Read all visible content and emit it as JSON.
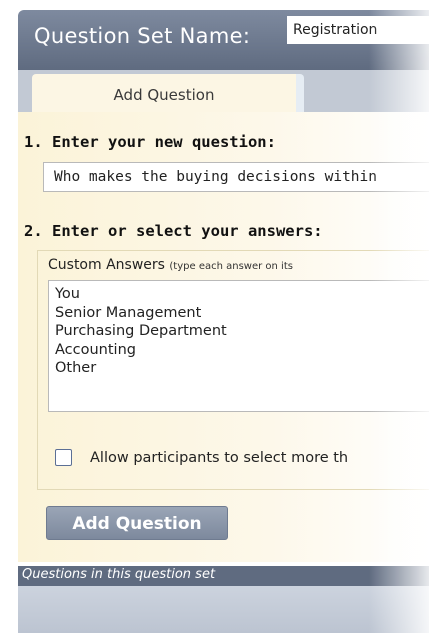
{
  "header": {
    "label": "Question Set Name:",
    "name_value": "Registration"
  },
  "tabs": [
    {
      "label": "Add Question",
      "active": true
    }
  ],
  "step1": {
    "label": "1. Enter your new question:",
    "question_value": "Who makes the buying decisions within"
  },
  "step2": {
    "label": "2. Enter or select your answers:",
    "custom_answers_label": "Custom Answers",
    "custom_answers_hint": "(type each answer on its",
    "answers": [
      "You",
      "Senior Management",
      "Purchasing Department",
      "Accounting",
      "Other"
    ],
    "multi_select_label": "Allow participants to select more th"
  },
  "actions": {
    "add_question_label": "Add Question"
  },
  "questions_list": {
    "label": "Questions in this question set"
  },
  "colors": {
    "header": "#6b778c",
    "tab_bar": "#c2c9d4",
    "panel": "#fbf3d8",
    "button": "#8b96a9"
  }
}
